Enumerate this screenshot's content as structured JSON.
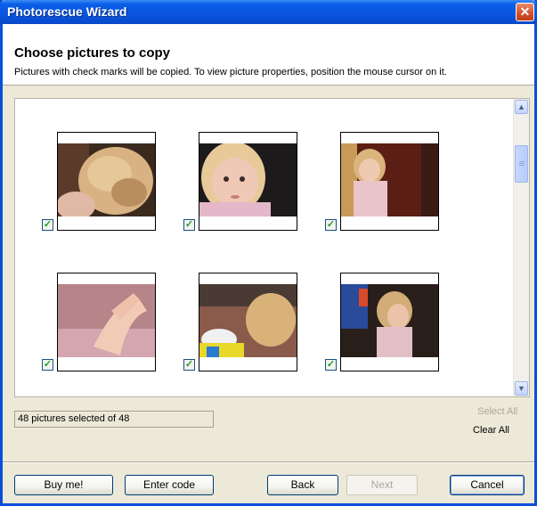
{
  "window": {
    "title": "Photorescue Wizard",
    "close_glyph": "✕"
  },
  "header": {
    "heading": "Choose pictures to copy",
    "subtext": "Pictures with check marks will be copied.  To view picture properties, position the mouse cursor on it."
  },
  "gallery": {
    "thumbnails": [
      {
        "checked": true,
        "check_glyph": "✓"
      },
      {
        "checked": true,
        "check_glyph": "✓"
      },
      {
        "checked": true,
        "check_glyph": "✓"
      },
      {
        "checked": true,
        "check_glyph": "✓"
      },
      {
        "checked": true,
        "check_glyph": "✓"
      },
      {
        "checked": true,
        "check_glyph": "✓"
      }
    ],
    "scroll_up_glyph": "▲",
    "scroll_down_glyph": "▼"
  },
  "status": {
    "selected_text": "48 pictures selected of 48"
  },
  "links": {
    "select_all": "Select All",
    "clear_all": "Clear All"
  },
  "buttons": {
    "buy": "Buy me!",
    "enter_code": "Enter code",
    "back": "Back",
    "next": "Next",
    "cancel": "Cancel"
  },
  "colors": {
    "titlebar": "#0a55e0",
    "checkmark": "#21a121",
    "dialog_bg": "#ece9d8"
  }
}
